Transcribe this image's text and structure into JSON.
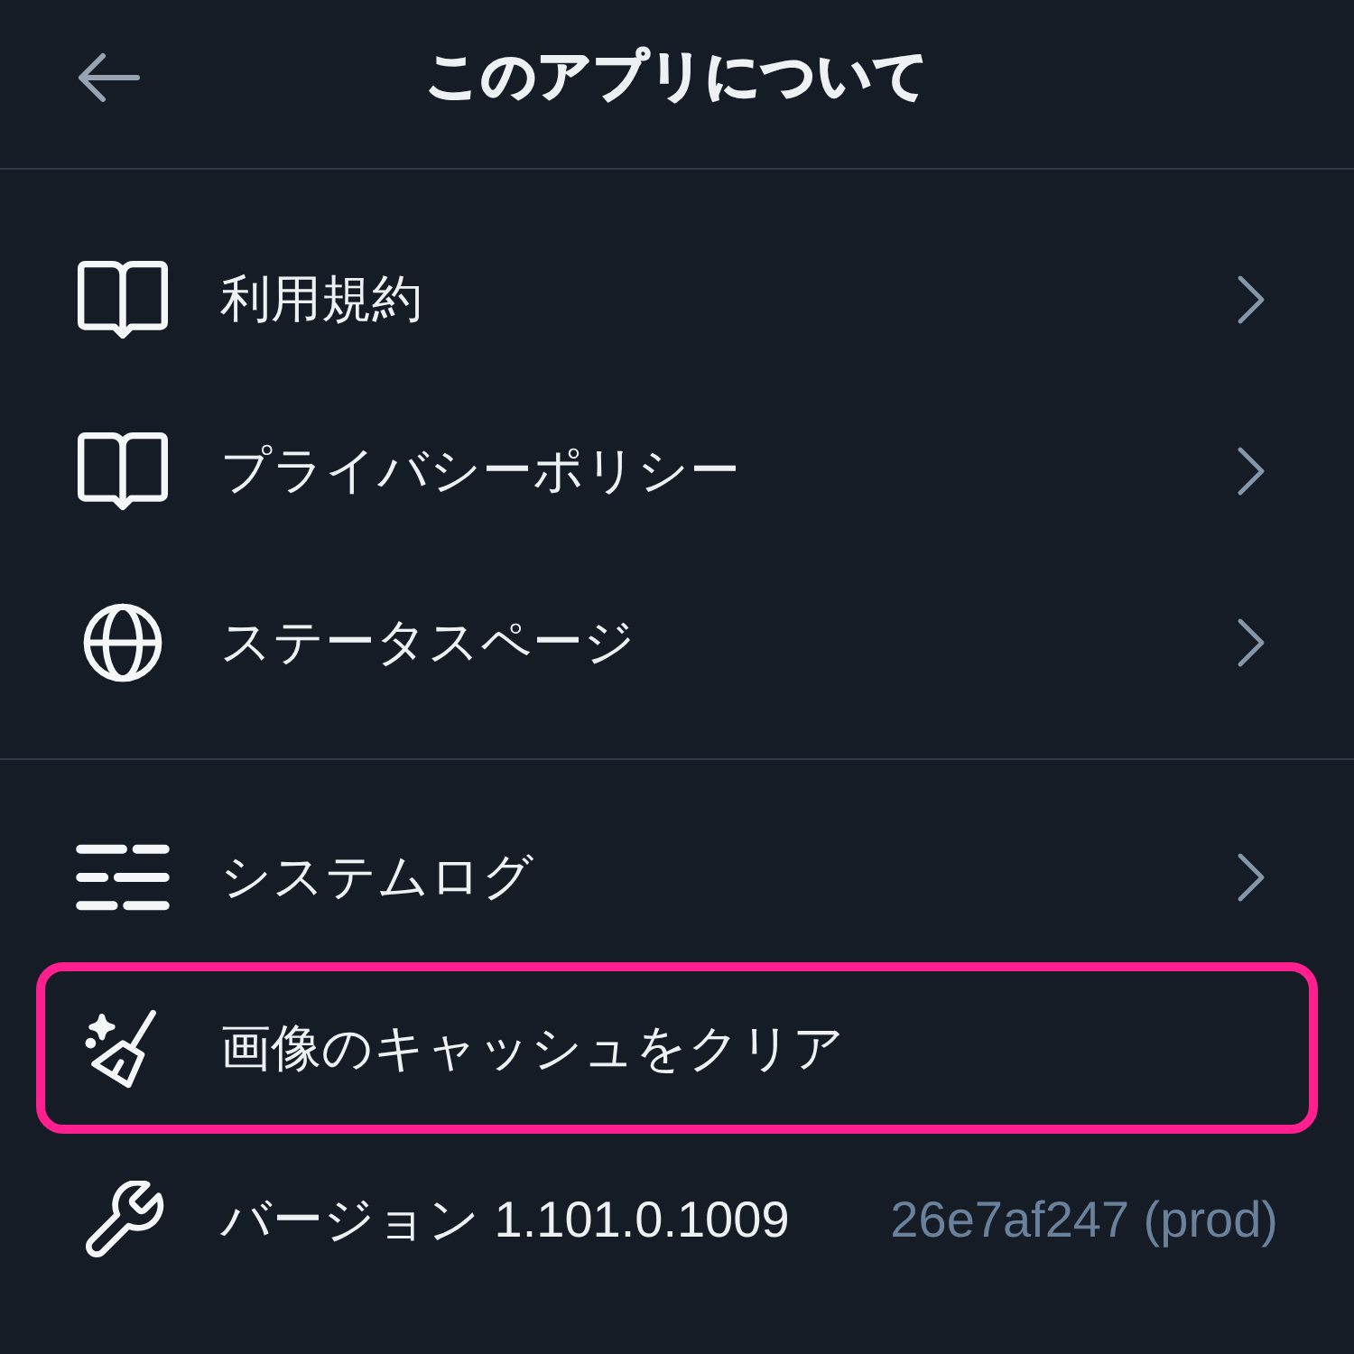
{
  "header": {
    "title": "このアプリについて"
  },
  "sections": [
    {
      "items": [
        {
          "kind": "link",
          "label": "利用規約",
          "highlighted": false
        },
        {
          "kind": "link",
          "label": "プライバシーポリシー",
          "highlighted": false
        },
        {
          "kind": "link",
          "label": "ステータスページ",
          "highlighted": false
        }
      ]
    },
    {
      "items": [
        {
          "kind": "link",
          "label": "システムログ",
          "highlighted": false
        },
        {
          "kind": "action",
          "label": "画像のキャッシュをクリア",
          "highlighted": true
        },
        {
          "kind": "info",
          "label": "バージョン 1.101.0.1009",
          "value": "26e7af247 (prod)",
          "highlighted": false
        }
      ]
    }
  ]
}
